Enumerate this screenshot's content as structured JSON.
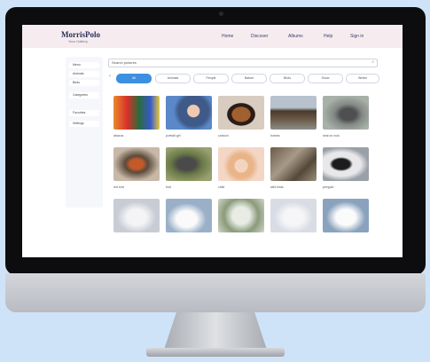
{
  "header": {
    "logo": "MorrisPolo",
    "logo_sub": "Your Gallery",
    "nav": [
      "Home",
      "Discover",
      "Albums",
      "Help",
      "Sign in"
    ]
  },
  "search": {
    "value": "Search pictures"
  },
  "filters": [
    "All",
    "Animals",
    "People",
    "Nature",
    "Birds",
    "Snow",
    "Winter"
  ],
  "sidebar": [
    "Menu",
    "Animals",
    "Birds",
    "Categories",
    "Favorites",
    "Settings"
  ],
  "captions_row1": [
    "abacus",
    "portrait girl",
    "cartoon",
    "horses",
    "seal on rock"
  ],
  "captions_row2": [
    "red bird",
    "bird",
    "child",
    "wild birds",
    "penguin"
  ],
  "colors": {
    "accent": "#3d8fe0",
    "header_bg": "#f6ecef",
    "background": "#cfe3f8"
  }
}
